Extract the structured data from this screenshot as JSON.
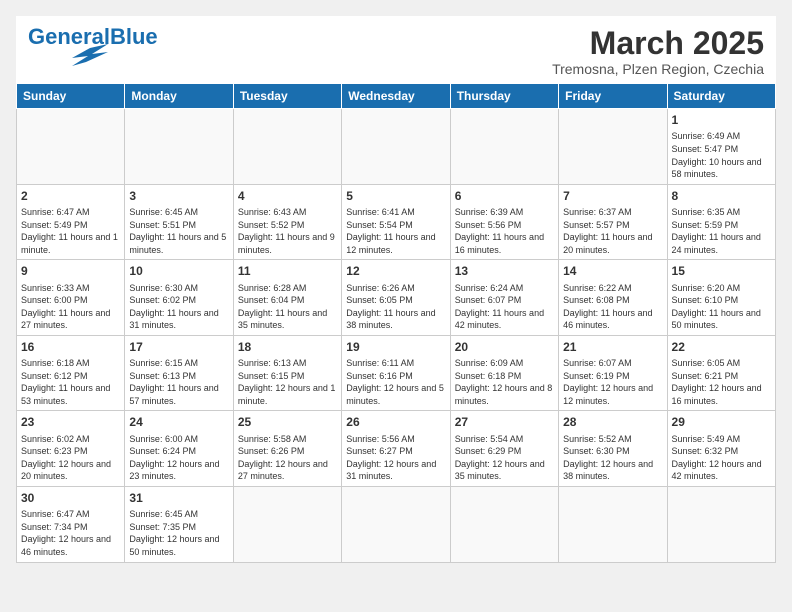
{
  "header": {
    "logo_general": "General",
    "logo_blue": "Blue",
    "month_title": "March 2025",
    "location": "Tremosna, Plzen Region, Czechia"
  },
  "days_of_week": [
    "Sunday",
    "Monday",
    "Tuesday",
    "Wednesday",
    "Thursday",
    "Friday",
    "Saturday"
  ],
  "weeks": [
    [
      {
        "day": "",
        "info": ""
      },
      {
        "day": "",
        "info": ""
      },
      {
        "day": "",
        "info": ""
      },
      {
        "day": "",
        "info": ""
      },
      {
        "day": "",
        "info": ""
      },
      {
        "day": "",
        "info": ""
      },
      {
        "day": "1",
        "info": "Sunrise: 6:49 AM\nSunset: 5:47 PM\nDaylight: 10 hours and 58 minutes."
      }
    ],
    [
      {
        "day": "2",
        "info": "Sunrise: 6:47 AM\nSunset: 5:49 PM\nDaylight: 11 hours and 1 minute."
      },
      {
        "day": "3",
        "info": "Sunrise: 6:45 AM\nSunset: 5:51 PM\nDaylight: 11 hours and 5 minutes."
      },
      {
        "day": "4",
        "info": "Sunrise: 6:43 AM\nSunset: 5:52 PM\nDaylight: 11 hours and 9 minutes."
      },
      {
        "day": "5",
        "info": "Sunrise: 6:41 AM\nSunset: 5:54 PM\nDaylight: 11 hours and 12 minutes."
      },
      {
        "day": "6",
        "info": "Sunrise: 6:39 AM\nSunset: 5:56 PM\nDaylight: 11 hours and 16 minutes."
      },
      {
        "day": "7",
        "info": "Sunrise: 6:37 AM\nSunset: 5:57 PM\nDaylight: 11 hours and 20 minutes."
      },
      {
        "day": "8",
        "info": "Sunrise: 6:35 AM\nSunset: 5:59 PM\nDaylight: 11 hours and 24 minutes."
      }
    ],
    [
      {
        "day": "9",
        "info": "Sunrise: 6:33 AM\nSunset: 6:00 PM\nDaylight: 11 hours and 27 minutes."
      },
      {
        "day": "10",
        "info": "Sunrise: 6:30 AM\nSunset: 6:02 PM\nDaylight: 11 hours and 31 minutes."
      },
      {
        "day": "11",
        "info": "Sunrise: 6:28 AM\nSunset: 6:04 PM\nDaylight: 11 hours and 35 minutes."
      },
      {
        "day": "12",
        "info": "Sunrise: 6:26 AM\nSunset: 6:05 PM\nDaylight: 11 hours and 38 minutes."
      },
      {
        "day": "13",
        "info": "Sunrise: 6:24 AM\nSunset: 6:07 PM\nDaylight: 11 hours and 42 minutes."
      },
      {
        "day": "14",
        "info": "Sunrise: 6:22 AM\nSunset: 6:08 PM\nDaylight: 11 hours and 46 minutes."
      },
      {
        "day": "15",
        "info": "Sunrise: 6:20 AM\nSunset: 6:10 PM\nDaylight: 11 hours and 50 minutes."
      }
    ],
    [
      {
        "day": "16",
        "info": "Sunrise: 6:18 AM\nSunset: 6:12 PM\nDaylight: 11 hours and 53 minutes."
      },
      {
        "day": "17",
        "info": "Sunrise: 6:15 AM\nSunset: 6:13 PM\nDaylight: 11 hours and 57 minutes."
      },
      {
        "day": "18",
        "info": "Sunrise: 6:13 AM\nSunset: 6:15 PM\nDaylight: 12 hours and 1 minute."
      },
      {
        "day": "19",
        "info": "Sunrise: 6:11 AM\nSunset: 6:16 PM\nDaylight: 12 hours and 5 minutes."
      },
      {
        "day": "20",
        "info": "Sunrise: 6:09 AM\nSunset: 6:18 PM\nDaylight: 12 hours and 8 minutes."
      },
      {
        "day": "21",
        "info": "Sunrise: 6:07 AM\nSunset: 6:19 PM\nDaylight: 12 hours and 12 minutes."
      },
      {
        "day": "22",
        "info": "Sunrise: 6:05 AM\nSunset: 6:21 PM\nDaylight: 12 hours and 16 minutes."
      }
    ],
    [
      {
        "day": "23",
        "info": "Sunrise: 6:02 AM\nSunset: 6:23 PM\nDaylight: 12 hours and 20 minutes."
      },
      {
        "day": "24",
        "info": "Sunrise: 6:00 AM\nSunset: 6:24 PM\nDaylight: 12 hours and 23 minutes."
      },
      {
        "day": "25",
        "info": "Sunrise: 5:58 AM\nSunset: 6:26 PM\nDaylight: 12 hours and 27 minutes."
      },
      {
        "day": "26",
        "info": "Sunrise: 5:56 AM\nSunset: 6:27 PM\nDaylight: 12 hours and 31 minutes."
      },
      {
        "day": "27",
        "info": "Sunrise: 5:54 AM\nSunset: 6:29 PM\nDaylight: 12 hours and 35 minutes."
      },
      {
        "day": "28",
        "info": "Sunrise: 5:52 AM\nSunset: 6:30 PM\nDaylight: 12 hours and 38 minutes."
      },
      {
        "day": "29",
        "info": "Sunrise: 5:49 AM\nSunset: 6:32 PM\nDaylight: 12 hours and 42 minutes."
      }
    ],
    [
      {
        "day": "30",
        "info": "Sunrise: 6:47 AM\nSunset: 7:34 PM\nDaylight: 12 hours and 46 minutes."
      },
      {
        "day": "31",
        "info": "Sunrise: 6:45 AM\nSunset: 7:35 PM\nDaylight: 12 hours and 50 minutes."
      },
      {
        "day": "",
        "info": ""
      },
      {
        "day": "",
        "info": ""
      },
      {
        "day": "",
        "info": ""
      },
      {
        "day": "",
        "info": ""
      },
      {
        "day": "",
        "info": ""
      }
    ]
  ]
}
